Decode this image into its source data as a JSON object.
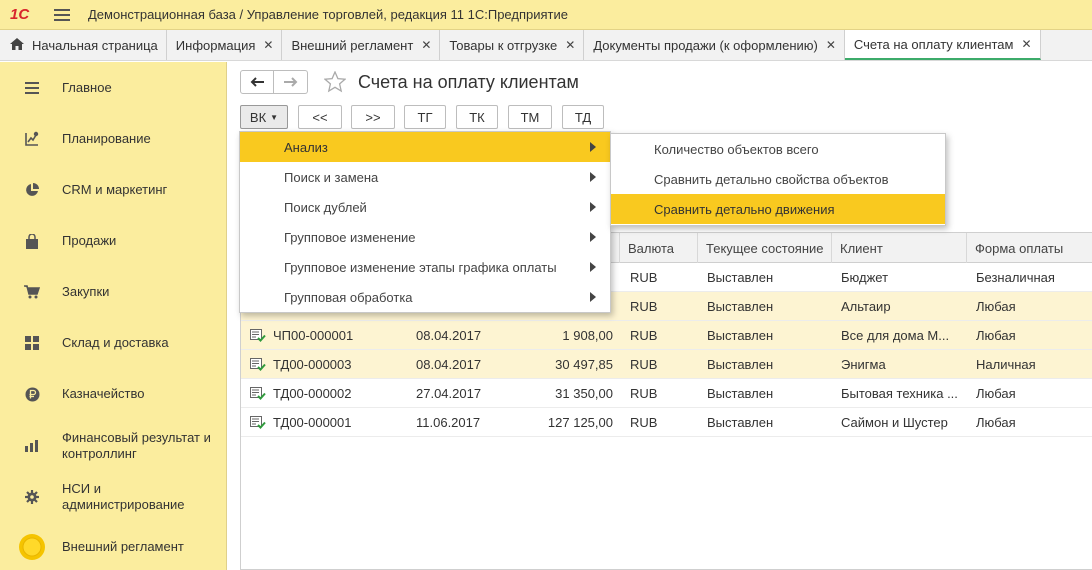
{
  "app": {
    "title": "Демонстрационная база / Управление торговлей, редакция 11 1С:Предприятие",
    "logo_text": "1С"
  },
  "tabs": [
    {
      "label": "Начальная страница"
    },
    {
      "label": "Информация"
    },
    {
      "label": "Внешний регламент"
    },
    {
      "label": "Товары к отгрузке"
    },
    {
      "label": "Документы продажи (к оформлению)"
    },
    {
      "label": "Счета на оплату клиентам"
    }
  ],
  "sidebar": {
    "items": [
      {
        "label": "Главное",
        "icon": "list-icon"
      },
      {
        "label": "Планирование",
        "icon": "planning-icon"
      },
      {
        "label": "CRM и маркетинг",
        "icon": "pie-chart-icon"
      },
      {
        "label": "Продажи",
        "icon": "shopping-bag-icon"
      },
      {
        "label": "Закупки",
        "icon": "cart-icon"
      },
      {
        "label": "Склад и доставка",
        "icon": "warehouse-grid-icon"
      },
      {
        "label": "Казначейство",
        "icon": "ruble-icon"
      },
      {
        "label": "Финансовый результат и контроллинг",
        "icon": "bar-chart-icon"
      },
      {
        "label": "НСИ и администрирование",
        "icon": "gear-icon"
      },
      {
        "label": "Внешний регламент",
        "icon": "yellow-circle-icon"
      }
    ]
  },
  "page": {
    "title": "Счета на оплату клиентам"
  },
  "toolbar": {
    "buttons": [
      {
        "label": "ВК"
      },
      {
        "label": "<<"
      },
      {
        "label": ">>"
      },
      {
        "label": "ТГ"
      },
      {
        "label": "ТК"
      },
      {
        "label": "ТМ"
      },
      {
        "label": "ТД"
      }
    ]
  },
  "menu": {
    "items": [
      {
        "label": "Анализ"
      },
      {
        "label": "Поиск и замена"
      },
      {
        "label": "Поиск дублей"
      },
      {
        "label": "Групповое изменение"
      },
      {
        "label": "Групповое изменение этапы графика оплаты"
      },
      {
        "label": "Групповая обработка"
      }
    ],
    "submenu": [
      {
        "label": "Количество объектов всего"
      },
      {
        "label": "Сравнить детально свойства объектов"
      },
      {
        "label": "Сравнить детально движения"
      }
    ]
  },
  "table": {
    "columns": [
      "Валюта",
      "Текущее состояние",
      "Клиент",
      "Форма оплаты"
    ],
    "rows": [
      {
        "number": "",
        "date": "",
        "amount": "",
        "currency": "RUB",
        "state": "Выставлен",
        "client": "Бюджет",
        "payment": "Безналичная"
      },
      {
        "number": "",
        "date": "",
        "amount": "",
        "currency": "RUB",
        "state": "Выставлен",
        "client": "Альтаир",
        "payment": "Любая"
      },
      {
        "number": "ЧП00-000001",
        "date": "08.04.2017",
        "amount": "1 908,00",
        "currency": "RUB",
        "state": "Выставлен",
        "client": "Все для дома М...",
        "payment": "Любая"
      },
      {
        "number": "ТД00-000003",
        "date": "08.04.2017",
        "amount": "30 497,85",
        "currency": "RUB",
        "state": "Выставлен",
        "client": "Энигма",
        "payment": "Наличная"
      },
      {
        "number": "ТД00-000002",
        "date": "27.04.2017",
        "amount": "31 350,00",
        "currency": "RUB",
        "state": "Выставлен",
        "client": "Бытовая техника ...",
        "payment": "Любая"
      },
      {
        "number": "ТД00-000001",
        "date": "11.06.2017",
        "amount": "127 125,00",
        "currency": "RUB",
        "state": "Выставлен",
        "client": "Саймон и Шустер",
        "payment": "Любая"
      }
    ]
  },
  "colors": {
    "accent": "#f9c91f",
    "sidebar_bg": "#fbed9e",
    "row_alt": "#fdf4d2",
    "active_tab": "#3cab6a",
    "logo": "#d8262c"
  }
}
